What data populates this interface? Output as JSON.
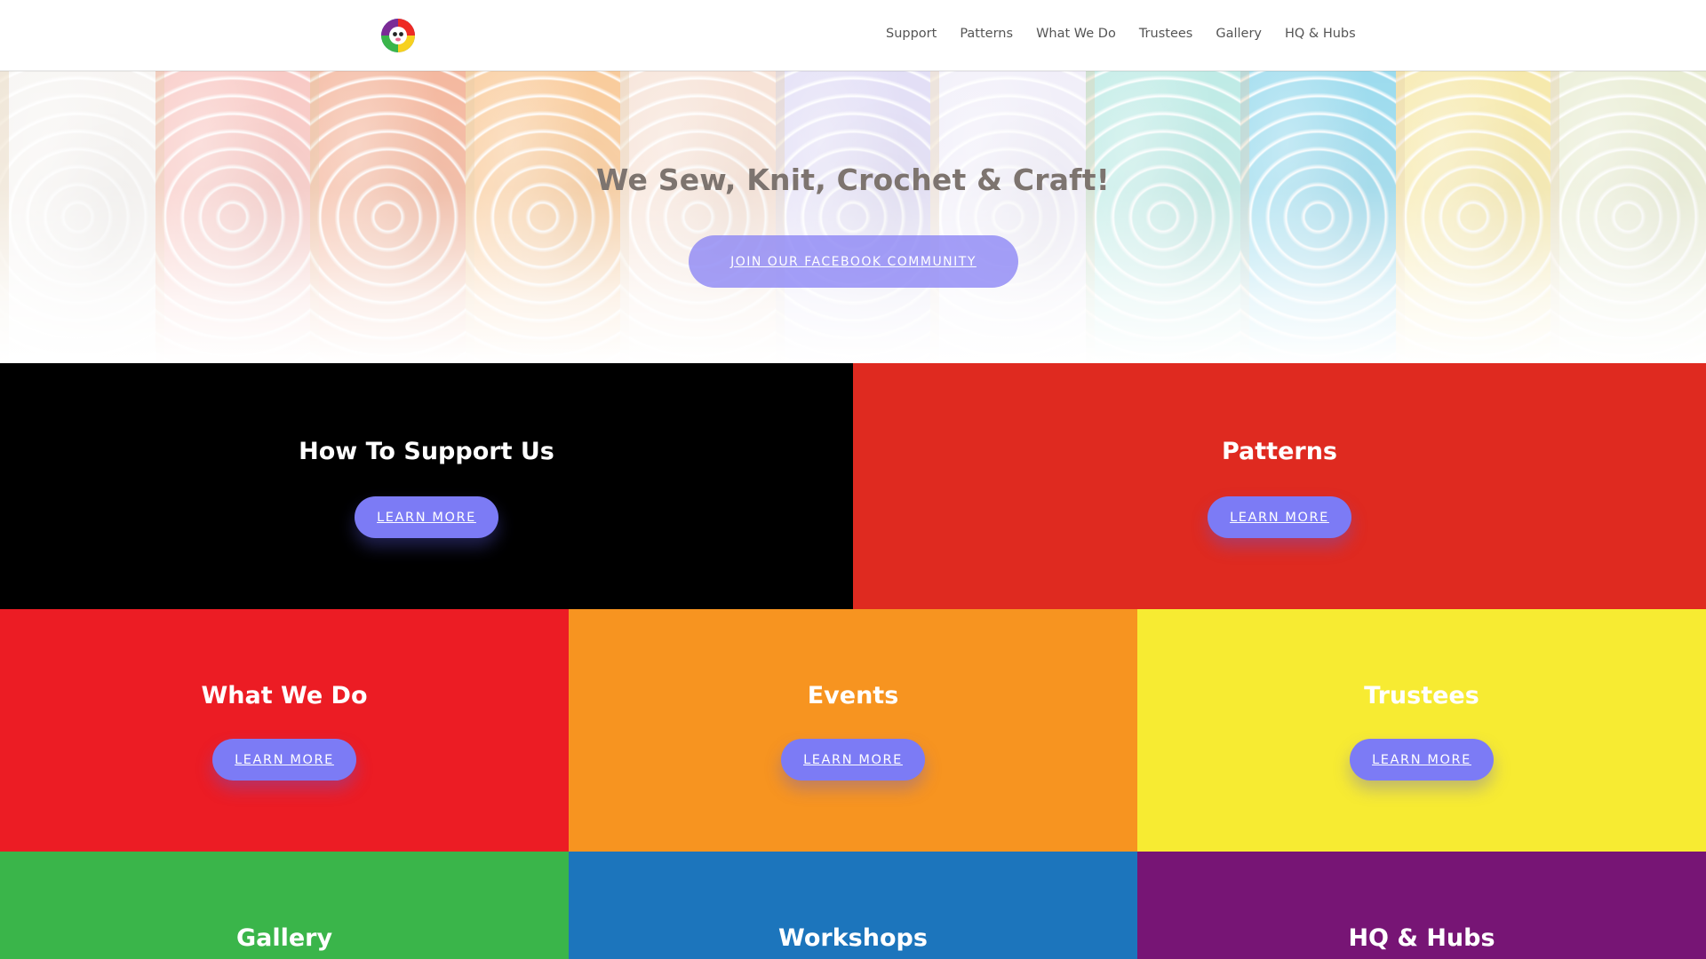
{
  "header": {
    "logo_icon": "rainbow-sheep-logo",
    "nav": [
      "Support",
      "Patterns",
      "What We Do",
      "Trustees",
      "Gallery",
      "HQ & Hubs"
    ]
  },
  "hero": {
    "title": "We Sew, Knit, Crochet & Craft!",
    "button_label": "JOIN OUR FACEBOOK COMMUNITY",
    "yarn_colors": [
      "#f4f1ee",
      "#f6b8b2",
      "#f0a07f",
      "#f7ba7a",
      "#f4d9c9",
      "#d9d4f3",
      "#ece9f7",
      "#a9e4dd",
      "#7bcfe8",
      "#f3e18f",
      "#e2e7c6"
    ]
  },
  "tiles": [
    {
      "title": "How To Support Us",
      "button": "LEARN MORE",
      "color": "#000000"
    },
    {
      "title": "Patterns",
      "button": "LEARN MORE",
      "color": "#df2a20"
    },
    {
      "title": "What We Do",
      "button": "LEARN MORE",
      "color": "#ec1c24"
    },
    {
      "title": "Events",
      "button": "LEARN MORE",
      "color": "#f79420"
    },
    {
      "title": "Trustees",
      "button": "LEARN MORE",
      "color": "#f7eb32"
    },
    {
      "title": "Gallery",
      "color": "#3ab54a"
    },
    {
      "title": "Workshops",
      "color": "#1c75bc"
    },
    {
      "title": "HQ & Hubs",
      "color": "#771575"
    }
  ],
  "colors": {
    "button": "#7c7bf5",
    "nav_text": "#555555",
    "hero_title": "#7d746f"
  }
}
